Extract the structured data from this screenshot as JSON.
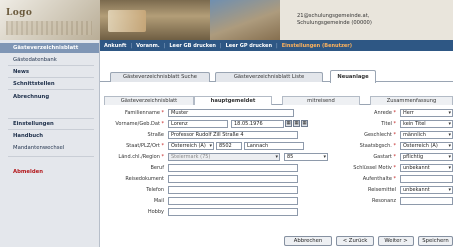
{
  "header": {
    "logo_text": "Logo",
    "school_line1": "21@schulungsgemeinde.at,",
    "school_line2": "Schulungsgemeinde (00000)"
  },
  "topnav": {
    "items": [
      "Ankunft",
      "Voranm.",
      "Leer GB drucken",
      "Leer GP drucken",
      "Einstellungen (Benutzer)"
    ]
  },
  "sidebar": {
    "items": [
      "Gästeverzeichnisblatt",
      "Gästedatenbank",
      "News",
      "Schnittstellen",
      "Abrechnung",
      "Einstellungen",
      "Handbuch",
      "Mandantenwechsel",
      "Abmelden"
    ]
  },
  "tabs": [
    "Gästeverzeichnisblatt Suche",
    "Gästeverzeichnisblatt Liste",
    "Neuanlage"
  ],
  "subtabs": [
    "Gästeverzeichnisblatt",
    "hauptgemeldet",
    "mitreisend",
    "Zusammenfassung"
  ],
  "form": {
    "left": [
      {
        "label": "Familienname",
        "req": true,
        "value": "Muster"
      },
      {
        "label": "Vorname/Geb.Dat",
        "req": true,
        "value": "Lorenz",
        "value2": "18.05.1976"
      },
      {
        "label": "Straße",
        "req": false,
        "value": "Professor Rudolf Zill Straße 4"
      },
      {
        "label": "Staat/PLZ/Ort",
        "req": true,
        "value": "Österreich (A)",
        "value2": "8502",
        "value3": "Lannach"
      },
      {
        "label": "Länd.chl./Region",
        "req": true,
        "value": "Steiermark (75)",
        "value2": "85"
      },
      {
        "label": "Beruf",
        "req": false,
        "value": ""
      },
      {
        "label": "Reisedokument",
        "req": false,
        "value": ""
      },
      {
        "label": "Telefon",
        "req": false,
        "value": ""
      },
      {
        "label": "Mail",
        "req": false,
        "value": ""
      },
      {
        "label": "Hobby",
        "req": false,
        "value": ""
      }
    ],
    "right": [
      {
        "label": "Anrede",
        "req": true,
        "value": "Herr"
      },
      {
        "label": "Titel",
        "req": true,
        "value": "kein Titel"
      },
      {
        "label": "Geschlecht",
        "req": true,
        "value": "männlich"
      },
      {
        "label": "Staatsbgsch.",
        "req": true,
        "value": "Österreich (A)"
      },
      {
        "label": "Gastart",
        "req": true,
        "value": "pflichtig"
      },
      {
        "label": "Schlüssel Motiv",
        "req": true,
        "value": "unbekannt"
      },
      {
        "label": "Aufenthalte",
        "req": true,
        "value": ""
      },
      {
        "label": "Reisemittel",
        "req": false,
        "value": "unbekannt"
      },
      {
        "label": "Resonanz",
        "req": false,
        "value": ""
      }
    ]
  },
  "buttons": [
    "Abbrechen",
    "< Zurück",
    "Weiter >",
    "Speichern"
  ],
  "colors": {
    "nav": "#2e5784",
    "highlight": "#7f96b5",
    "logout": "#b3171b",
    "active_nav": "#ffb35c"
  }
}
